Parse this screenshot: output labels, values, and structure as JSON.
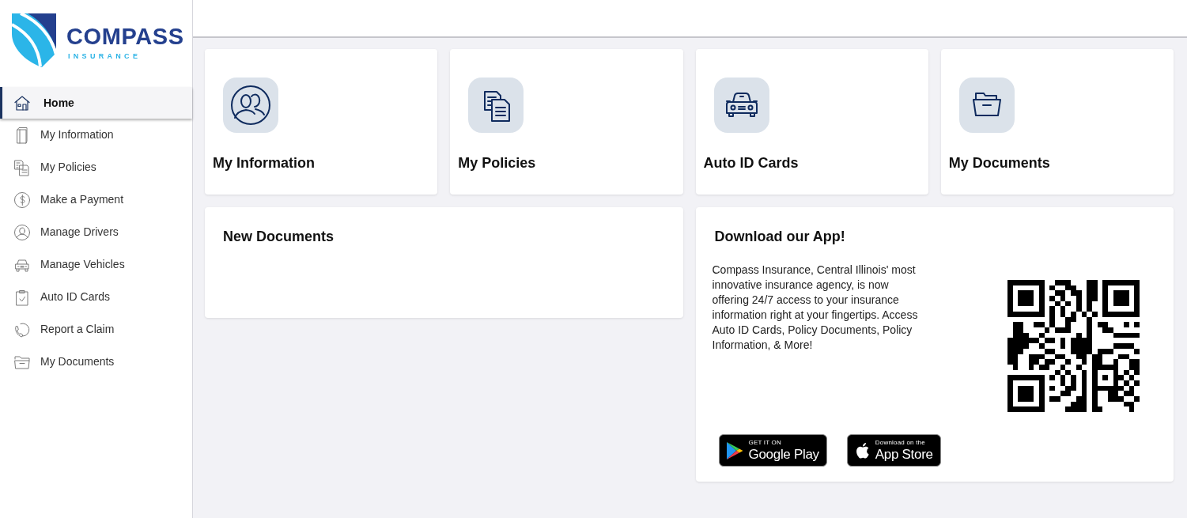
{
  "logo": {
    "wordmark": "COMPASS",
    "tagline": "INSURANCE"
  },
  "sidebar": {
    "items": [
      {
        "label": "Home",
        "selected": true
      },
      {
        "label": "My Information",
        "selected": false
      },
      {
        "label": "My Policies",
        "selected": false
      },
      {
        "label": "Make a Payment",
        "selected": false
      },
      {
        "label": "Manage Drivers",
        "selected": false
      },
      {
        "label": "Manage Vehicles",
        "selected": false
      },
      {
        "label": "Auto ID Cards",
        "selected": false
      },
      {
        "label": "Report a Claim",
        "selected": false
      },
      {
        "label": "My Documents",
        "selected": false
      }
    ]
  },
  "tiles": [
    {
      "title": "My Information"
    },
    {
      "title": "My Policies"
    },
    {
      "title": "Auto ID Cards"
    },
    {
      "title": "My Documents"
    }
  ],
  "new_documents": {
    "title": "New Documents"
  },
  "app_promo": {
    "title": "Download our App!",
    "text": "Compass Insurance, Central Illinois' most innovative insurance agency, is now offering 24/7 access to your insurance information right at your fingertips. Access Auto ID Cards, Policy Documents, Policy Information, & More!",
    "store_badges": [
      {
        "caption": "GET IT ON",
        "store": "Google Play"
      },
      {
        "caption": "Download on the",
        "store": "App Store"
      }
    ]
  }
}
